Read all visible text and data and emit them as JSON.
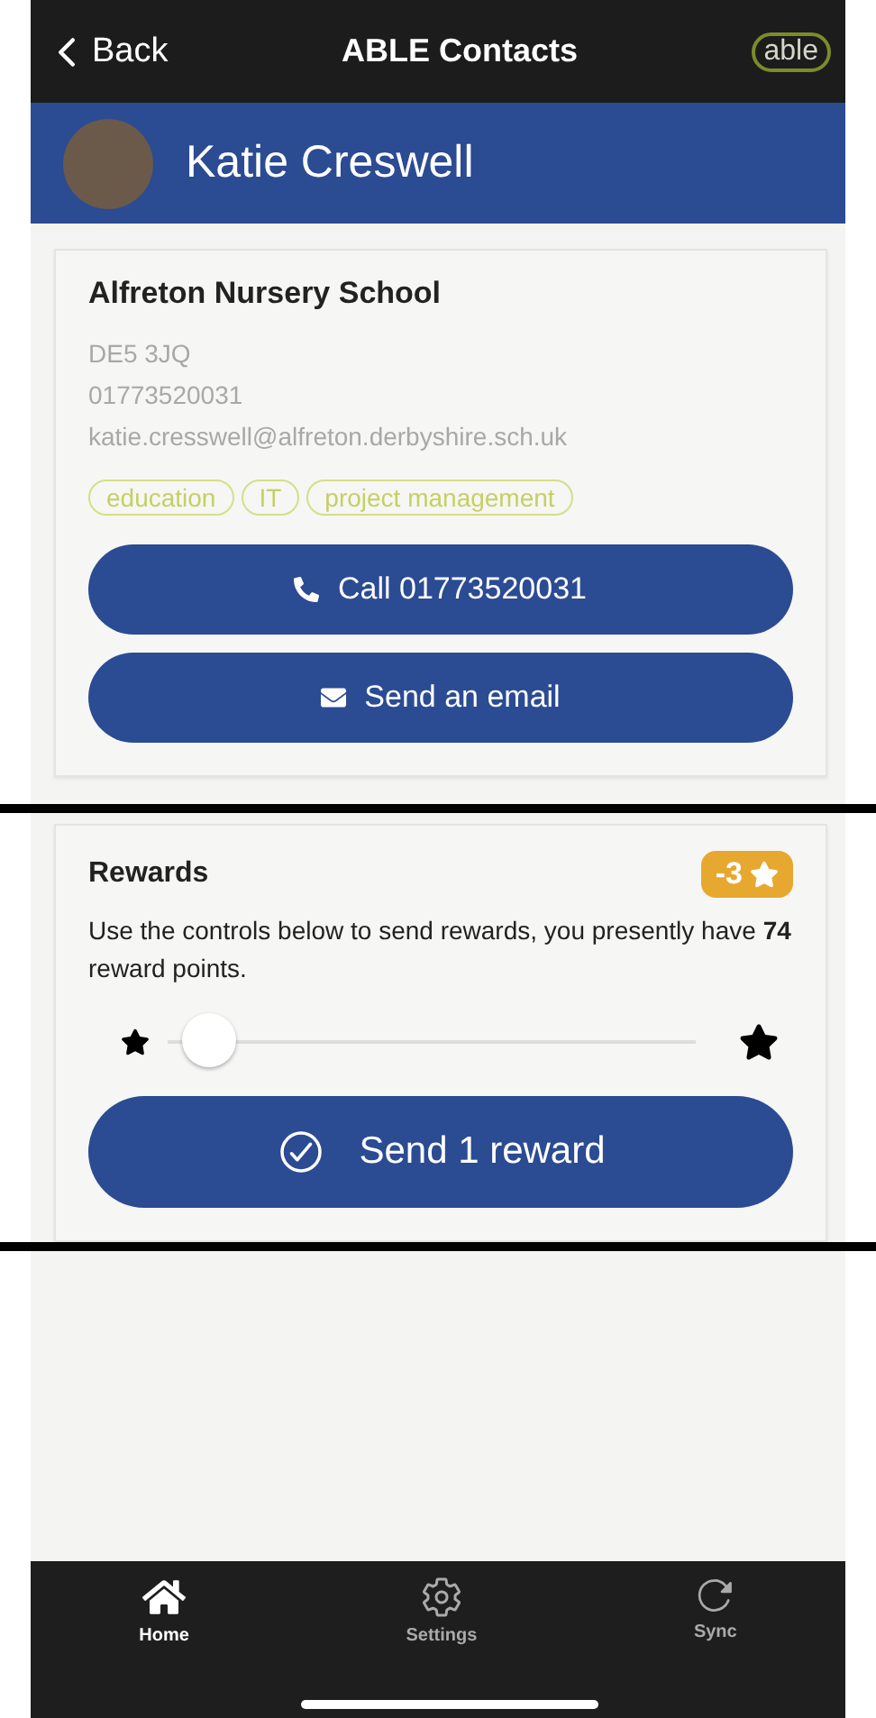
{
  "nav_bar": {
    "back": "Back",
    "title": "ABLE Contacts",
    "logo": "able"
  },
  "contact": {
    "name": "Katie Creswell"
  },
  "details": {
    "organisation": "Alfreton Nursery School",
    "lines": [
      "DE5 3JQ",
      "01773520031",
      "katie.cresswell@alfreton.derbyshire.sch.uk"
    ],
    "tags": [
      "education",
      "IT",
      "project management"
    ],
    "buttons": [
      {
        "kind": "phone",
        "label": "Call 01773520031"
      },
      {
        "kind": "email",
        "label": "Send an email"
      }
    ]
  },
  "rewards": {
    "title": "Rewards",
    "badge": "-3",
    "description": "Use the controls below to send rewards, you presently have **74** reward points.",
    "slider": {
      "level": 0.03
    },
    "button": "Send 1 reward"
  },
  "tab_bar": [
    {
      "kind": "home",
      "label": "Home",
      "selected": true
    },
    {
      "kind": "settings",
      "label": "Settings",
      "selected": false
    },
    {
      "kind": "sync",
      "label": "Sync",
      "selected": false
    }
  ]
}
